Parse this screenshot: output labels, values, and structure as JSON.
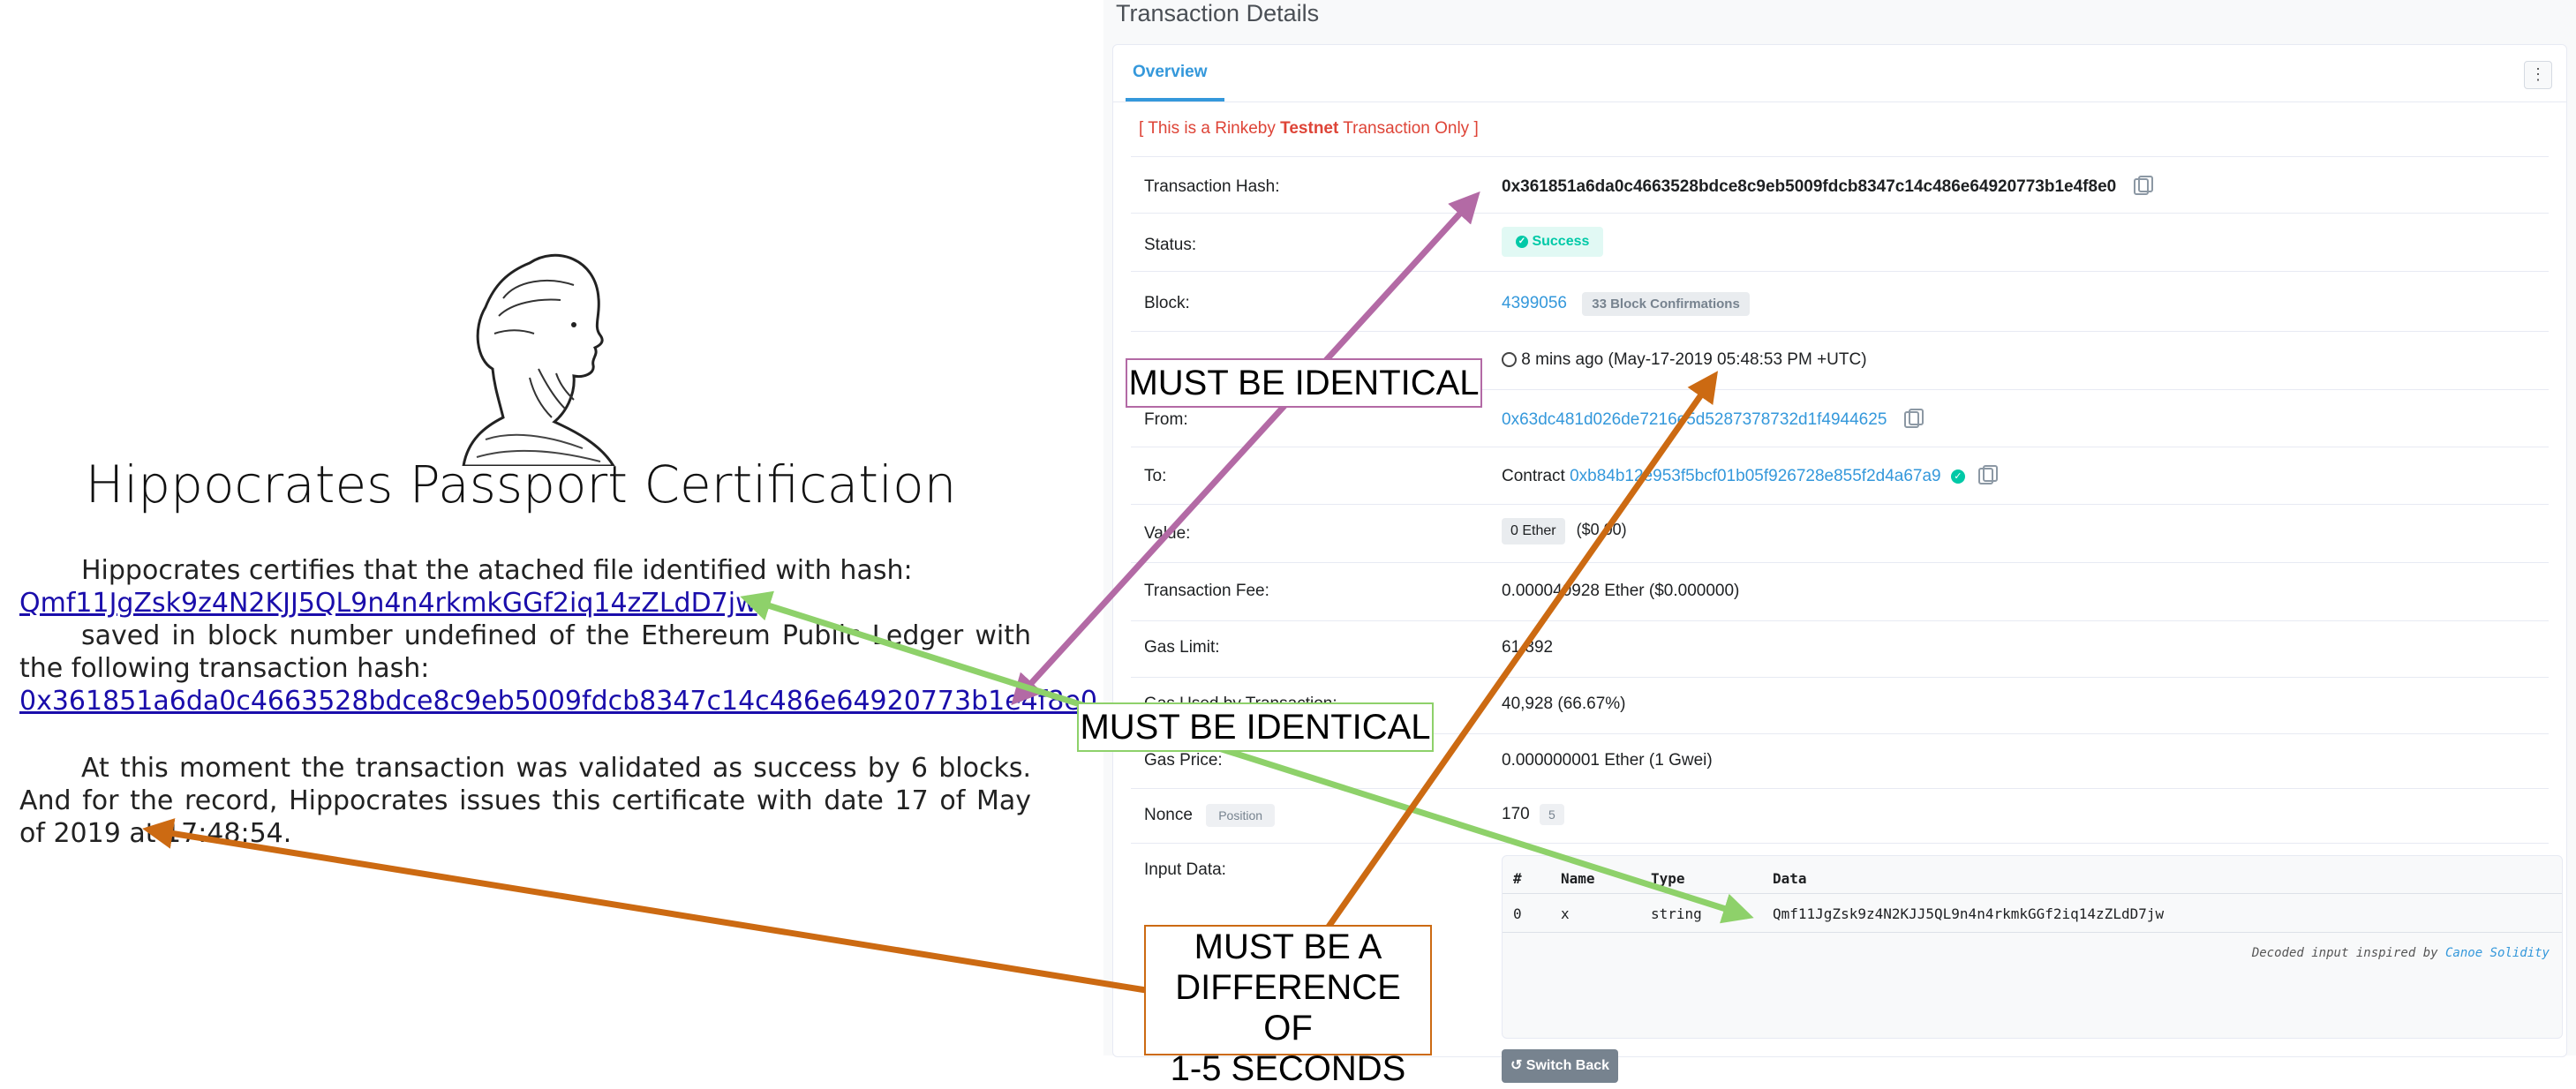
{
  "certificate": {
    "title": "Hippocrates Passport Certification",
    "paragraph1_intro": "Hippocrates certifies that the atached file identified with hash:",
    "file_hash": "Qmf11JgZsk9z4N2KJJ5QL9n4n4rkmkGGf2iq14zZLdD7jw",
    "paragraph1_middle": "saved in block number undefined of the Ethereum Public Ledger with the following transaction hash:",
    "tx_hash": "0x361851a6da0c4663528bdce8c9eb5009fdcb8347c14c486e64920773b1e4f8e0",
    "paragraph2": "At this moment the transaction was validated as success by 6 blocks. And for the record, Hippocrates issues this certificate with date 17 of May of 2019 at 17:48:54."
  },
  "panel": {
    "heading": "Transaction Details",
    "tab_overview": "Overview",
    "menu_glyph": "⋮",
    "testnet_prefix": "[ This is a Rinkeby ",
    "testnet_bold": "Testnet",
    "testnet_suffix": " Transaction Only ]",
    "rows": {
      "tx_hash_label": "Transaction Hash:",
      "tx_hash_value": "0x361851a6da0c4663528bdce8c9eb5009fdcb8347c14c486e64920773b1e4f8e0",
      "status_label": "Status:",
      "status_value": "Success",
      "block_label": "Block:",
      "block_value": "4399056",
      "block_confirmations": "33 Block Confirmations",
      "timestamp_value": "8 mins ago (May-17-2019 05:48:53 PM +UTC)",
      "from_label": "From:",
      "from_value": "0x63dc481d026de7216e5d5287378732d1f4944625",
      "to_label": "To:",
      "to_prefix": "Contract ",
      "to_value": "0xb84b12e953f5bcf01b05f926728e855f2d4a67a9",
      "value_label": "Value:",
      "value_badge": "0 Ether",
      "value_usd": "($0.00)",
      "fee_label": "Transaction Fee:",
      "fee_value": "0.000040928 Ether ($0.000000)",
      "gas_limit_label": "Gas Limit:",
      "gas_limit_value": "61,392",
      "gas_used_label": "Gas Used by Transaction:",
      "gas_used_value": "40,928 (66.67%)",
      "gas_price_label": "Gas Price:",
      "gas_price_value": "0.000000001 Ether (1 Gwei)",
      "nonce_label": "Nonce",
      "nonce_position": "Position",
      "nonce_value": "170",
      "nonce_position_value": "5",
      "input_label": "Input Data:"
    },
    "input_table": {
      "headers": [
        "#",
        "Name",
        "Type",
        "Data"
      ],
      "row": [
        "0",
        "x",
        "string",
        "Qmf11JgZsk9z4N2KJJ5QL9n4n4rkmkGGf2iq14zZLdD7jw"
      ],
      "footer_prefix": "Decoded input inspired by ",
      "footer_link": "Canoe Solidity"
    },
    "switch_back": "Switch Back"
  },
  "callouts": {
    "identical_1": "MUST BE IDENTICAL",
    "identical_2": "MUST BE IDENTICAL",
    "difference_line1": "MUST BE A",
    "difference_line2": "DIFFERENCE OF",
    "difference_line3": "1-5 SECONDS"
  },
  "colors": {
    "arrow_purple": "#b36aa5",
    "arrow_green": "#8ed16a",
    "arrow_orange": "#cc6a12",
    "link_blue": "#3498db",
    "success_green": "#00c9a7",
    "testnet_red": "#de4437"
  }
}
